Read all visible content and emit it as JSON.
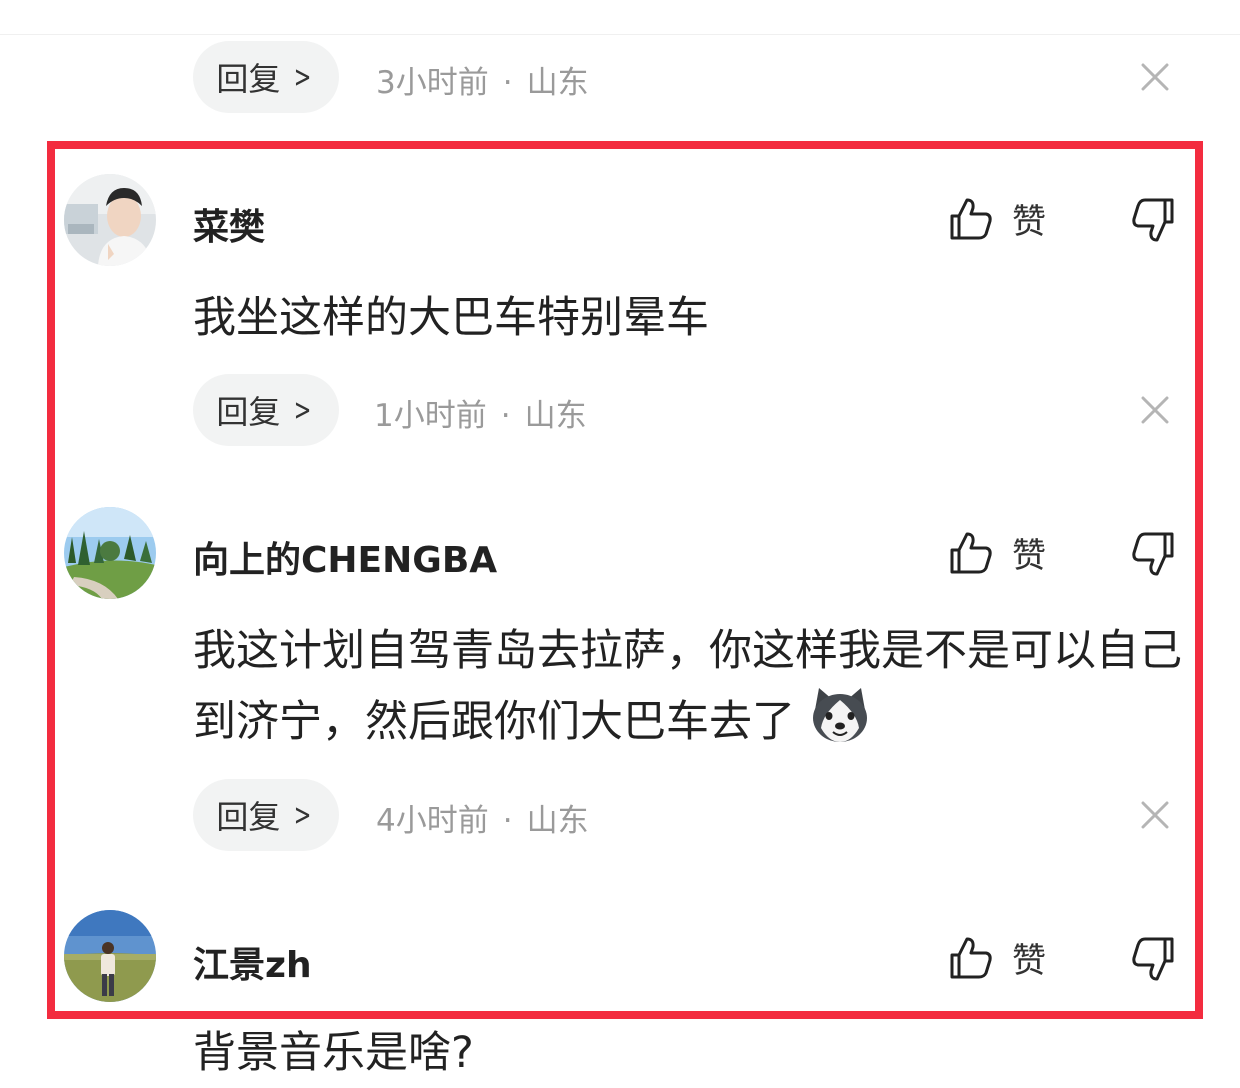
{
  "top_comment": {
    "reply_label": "回复",
    "time": "3小时前",
    "location": "山东"
  },
  "comments": [
    {
      "username": "菜樊",
      "text": "我坐这样的大巴车特别晕车",
      "like_label": "赞",
      "reply_label": "回复",
      "time": "1小时前",
      "location": "山东"
    },
    {
      "username": "向上的CHENGBA",
      "text": "我这计划自驾青岛去拉萨，你这样我是不是可以自己到济宁，然后跟你们大巴车去了",
      "like_label": "赞",
      "reply_label": "回复",
      "time": "4小时前",
      "location": "山东"
    },
    {
      "username": "江景zh",
      "text": "背景音乐是啥?",
      "like_label": "赞"
    }
  ],
  "separator": "·",
  "colors": {
    "highlight": "#f32c3f",
    "meta": "#9a9a9a",
    "pill": "#f2f3f3"
  }
}
